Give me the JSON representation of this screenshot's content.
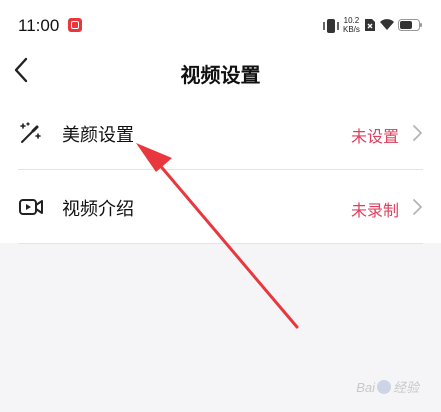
{
  "status_bar": {
    "time": "11:00",
    "net_speed_value": "10.2",
    "net_speed_unit": "KB/s"
  },
  "header": {
    "title": "视频设置"
  },
  "settings": [
    {
      "label": "美颜设置",
      "value": "未设置",
      "icon": "magic-wand-icon"
    },
    {
      "label": "视频介绍",
      "value": "未录制",
      "icon": "video-camera-icon"
    }
  ],
  "watermark": {
    "text_left": "Bai",
    "text_right": "经验"
  },
  "colors": {
    "accent": "#e0405e",
    "arrow": "#e8383d",
    "background": "#f5f5f7"
  }
}
